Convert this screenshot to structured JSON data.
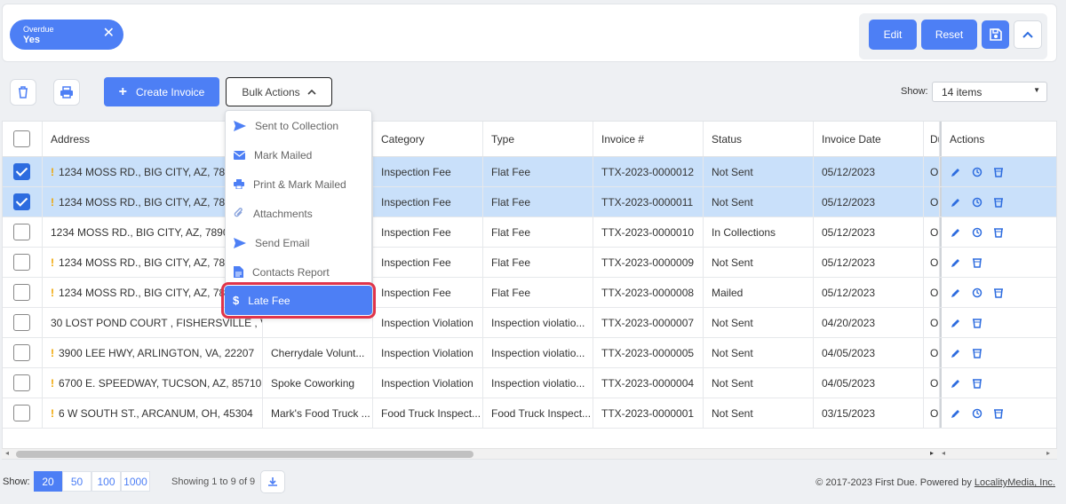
{
  "filters": {
    "chip": {
      "label": "Overdue",
      "value": "Yes"
    },
    "buttons": {
      "edit": "Edit",
      "reset": "Reset"
    }
  },
  "toolbar": {
    "create_invoice": "Create Invoice",
    "bulk_actions": "Bulk Actions",
    "show_label": "Show:",
    "show_value": "14 items"
  },
  "bulk_menu": {
    "items": [
      "Sent to Collection",
      "Mark Mailed",
      "Print & Mark Mailed",
      "Attachments",
      "Send Email",
      "Contacts Report",
      "Late Fee"
    ]
  },
  "table": {
    "columns": [
      "Address",
      "",
      "Category",
      "Type",
      "Invoice #",
      "Status",
      "Invoice Date",
      "Du",
      "Actions"
    ],
    "rows": [
      {
        "checked": true,
        "warn": true,
        "address": "1234 MOSS RD., BIG CITY, AZ, 78901",
        "name": "",
        "category": "Inspection Fee",
        "type": "Flat Fee",
        "invoice": "TTX-2023-0000012",
        "status": "Not Sent",
        "date": "05/12/2023",
        "due": "O",
        "actions": [
          "edit",
          "history",
          "delete"
        ]
      },
      {
        "checked": true,
        "warn": true,
        "address": "1234 MOSS RD., BIG CITY, AZ, 78901",
        "name": "",
        "category": "Inspection Fee",
        "type": "Flat Fee",
        "invoice": "TTX-2023-0000011",
        "status": "Not Sent",
        "date": "05/12/2023",
        "due": "O",
        "actions": [
          "edit",
          "history",
          "delete"
        ]
      },
      {
        "checked": false,
        "warn": false,
        "address": "1234 MOSS RD., BIG CITY, AZ, 78901",
        "name": "",
        "category": "Inspection Fee",
        "type": "Flat Fee",
        "invoice": "TTX-2023-0000010",
        "status": "In Collections",
        "date": "05/12/2023",
        "due": "O",
        "actions": [
          "edit",
          "history",
          "delete"
        ]
      },
      {
        "checked": false,
        "warn": true,
        "address": "1234 MOSS RD., BIG CITY, AZ, 78901",
        "name": "",
        "category": "Inspection Fee",
        "type": "Flat Fee",
        "invoice": "TTX-2023-0000009",
        "status": "Not Sent",
        "date": "05/12/2023",
        "due": "O",
        "actions": [
          "edit",
          "delete"
        ]
      },
      {
        "checked": false,
        "warn": true,
        "address": "1234 MOSS RD., BIG CITY, AZ, 78901",
        "name": "",
        "category": "Inspection Fee",
        "type": "Flat Fee",
        "invoice": "TTX-2023-0000008",
        "status": "Mailed",
        "date": "05/12/2023",
        "due": "O",
        "actions": [
          "edit",
          "history",
          "delete"
        ]
      },
      {
        "checked": false,
        "warn": false,
        "address": "30 LOST POND COURT , FISHERSVILLE , VA, 22939",
        "name": "",
        "category": "Inspection Violation",
        "type": "Inspection violatio...",
        "invoice": "TTX-2023-0000007",
        "status": "Not Sent",
        "date": "04/20/2023",
        "due": "O",
        "actions": [
          "edit",
          "delete"
        ]
      },
      {
        "checked": false,
        "warn": true,
        "address": "3900 LEE HWY, ARLINGTON, VA, 22207",
        "name": "Cherrydale Volunt...",
        "category": "Inspection Violation",
        "type": "Inspection violatio...",
        "invoice": "TTX-2023-0000005",
        "status": "Not Sent",
        "date": "04/05/2023",
        "due": "O",
        "actions": [
          "edit",
          "delete"
        ]
      },
      {
        "checked": false,
        "warn": true,
        "address": "6700 E. SPEEDWAY, TUCSON, AZ, 85710",
        "name": "Spoke Coworking",
        "category": "Inspection Violation",
        "type": "Inspection violatio...",
        "invoice": "TTX-2023-0000004",
        "status": "Not Sent",
        "date": "04/05/2023",
        "due": "O",
        "actions": [
          "edit",
          "delete"
        ]
      },
      {
        "checked": false,
        "warn": true,
        "address": "6 W SOUTH ST., ARCANUM, OH, 45304",
        "name": "Mark's Food Truck ...",
        "category": "Food Truck Inspect...",
        "type": "Food Truck Inspect...",
        "invoice": "TTX-2023-0000001",
        "status": "Not Sent",
        "date": "03/15/2023",
        "due": "O",
        "actions": [
          "edit",
          "history",
          "delete"
        ]
      }
    ]
  },
  "footer": {
    "show_label": "Show:",
    "page_sizes": [
      "20",
      "50",
      "100",
      "1000"
    ],
    "showing": "Showing 1 to 9 of 9",
    "copyright": "© 2017-2023 First Due. Powered by",
    "powered_link": "LocalityMedia, Inc."
  },
  "colors": {
    "accent": "#4d7ff5",
    "selected_row": "#c9e0fa",
    "warning": "#f0a500",
    "highlight": "#e0344a"
  }
}
